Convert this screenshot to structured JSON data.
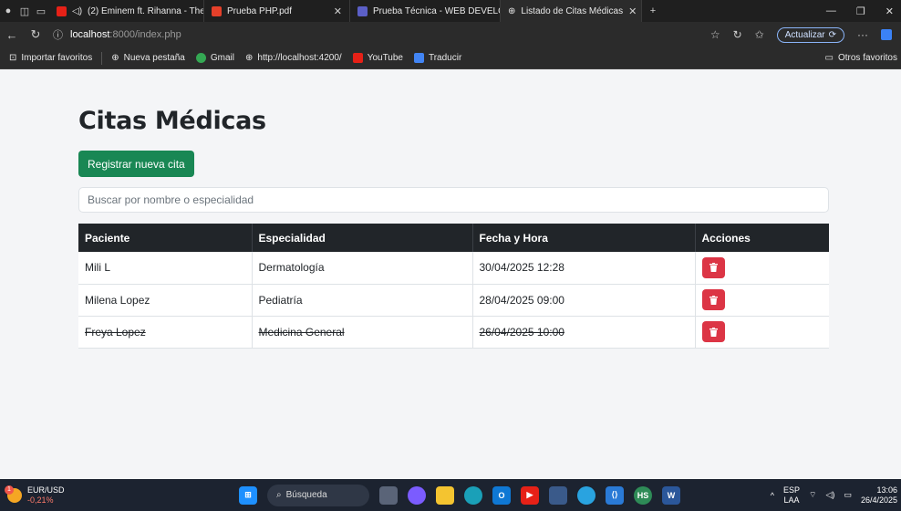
{
  "browser": {
    "tabs": [
      {
        "title": "(2) Eminem ft. Rihanna - The",
        "favicon_color": "#e62117"
      },
      {
        "title": "Prueba PHP.pdf",
        "favicon_color": "#e5402a"
      },
      {
        "title": "Prueba Técnica - WEB DEVELOPEI",
        "favicon_color": "#5b5fc7"
      },
      {
        "title": "Listado de Citas Médicas",
        "favicon_color": "#cfcfcf"
      }
    ],
    "url_host": "localhost",
    "url_rest": ":8000/index.php",
    "update_label": "Actualizar",
    "bookmarks": [
      "Importar favoritos",
      "Nueva pestaña",
      "Gmail",
      "http://localhost:4200/",
      "YouTube",
      "Traducir"
    ],
    "other_favorites": "Otros favoritos"
  },
  "page": {
    "title": "Citas Médicas",
    "new_button": "Registrar nueva cita",
    "search_placeholder": "Buscar por nombre o especialidad",
    "columns": [
      "Paciente",
      "Especialidad",
      "Fecha y Hora",
      "Acciones"
    ],
    "rows": [
      {
        "paciente": "Mili L",
        "especialidad": "Dermatología",
        "fecha": "30/04/2025 12:28",
        "completed": false
      },
      {
        "paciente": "Milena Lopez",
        "especialidad": "Pediatría",
        "fecha": "28/04/2025 09:00",
        "completed": false
      },
      {
        "paciente": "Freya Lopez",
        "especialidad": "Medicina General",
        "fecha": "26/04/2025 10:00",
        "completed": true
      }
    ],
    "colors": {
      "primary_btn": "#198754",
      "danger_btn": "#dc3545",
      "table_header": "#212529"
    }
  },
  "taskbar": {
    "ticker_name": "EUR/USD",
    "ticker_change": "-0,21%",
    "ticker_badge": "1",
    "search_label": "Búsqueda",
    "lang_top": "ESP",
    "lang_bottom": "LAA",
    "time": "13:06",
    "date": "26/4/2025"
  }
}
